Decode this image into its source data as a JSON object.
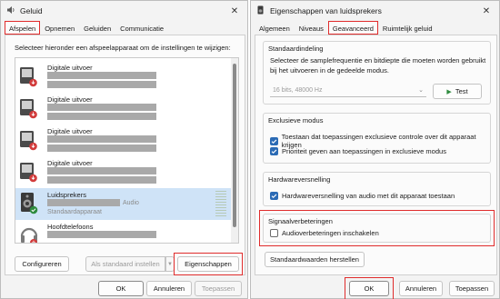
{
  "left_window": {
    "title": "Geluid",
    "tabs": [
      "Afspelen",
      "Opnemen",
      "Geluiden",
      "Communicatie"
    ],
    "instruction": "Selecteer hieronder een afspeelapparaat om de instellingen te wijzigen:",
    "devices": [
      {
        "name": "Digitale uitvoer",
        "sub1": "",
        "sub2": ""
      },
      {
        "name": "Digitale uitvoer",
        "sub1": "",
        "sub2": ""
      },
      {
        "name": "Digitale uitvoer",
        "sub1": "",
        "sub2": ""
      },
      {
        "name": "Digitale uitvoer",
        "sub1": "",
        "sub2": ""
      },
      {
        "name": "Luidsprekers",
        "sub1": "Audio",
        "sub2": "Standaardapparaat"
      },
      {
        "name": "Hoofdtelefoons",
        "sub1": "",
        "sub2": ""
      }
    ],
    "buttons": {
      "configure": "Configureren",
      "set_default": "Als standaard instellen",
      "properties": "Eigenschappen",
      "ok": "OK",
      "cancel": "Annuleren",
      "apply": "Toepassen"
    }
  },
  "right_window": {
    "title": "Eigenschappen van luidsprekers",
    "tabs": [
      "Algemeen",
      "Niveaus",
      "Geavanceerd",
      "Ruimtelijk geluid"
    ],
    "default_format": {
      "title": "Standaardindeling",
      "description": "Selecteer de samplefrequentie en bitdiepte die moeten worden gebruikt bij het uitvoeren in de gedeelde modus.",
      "format_value": "16 bits, 48000 Hz",
      "test_label": "Test"
    },
    "exclusive_mode": {
      "title": "Exclusieve modus",
      "option1": "Toestaan dat toepassingen exclusieve controle over dit apparaat krijgen",
      "option2": "Prioriteit geven aan toepassingen in exclusieve modus"
    },
    "hw_acceleration": {
      "title": "Hardwareversnelling",
      "option": "Hardwareversnelling van audio met dit apparaat toestaan"
    },
    "signal_enhancements": {
      "title": "Signaalverbeteringen",
      "option": "Audioverbeteringen inschakelen"
    },
    "restore_defaults": "Standaardwaarden herstellen",
    "buttons": {
      "ok": "OK",
      "cancel": "Annuleren",
      "apply": "Toepassen"
    }
  },
  "colors": {
    "highlight": "#e02c2c",
    "accent": "#2b6bb5",
    "selected_row": "#cfe3f7",
    "test_icon": "#2e8b3e"
  }
}
